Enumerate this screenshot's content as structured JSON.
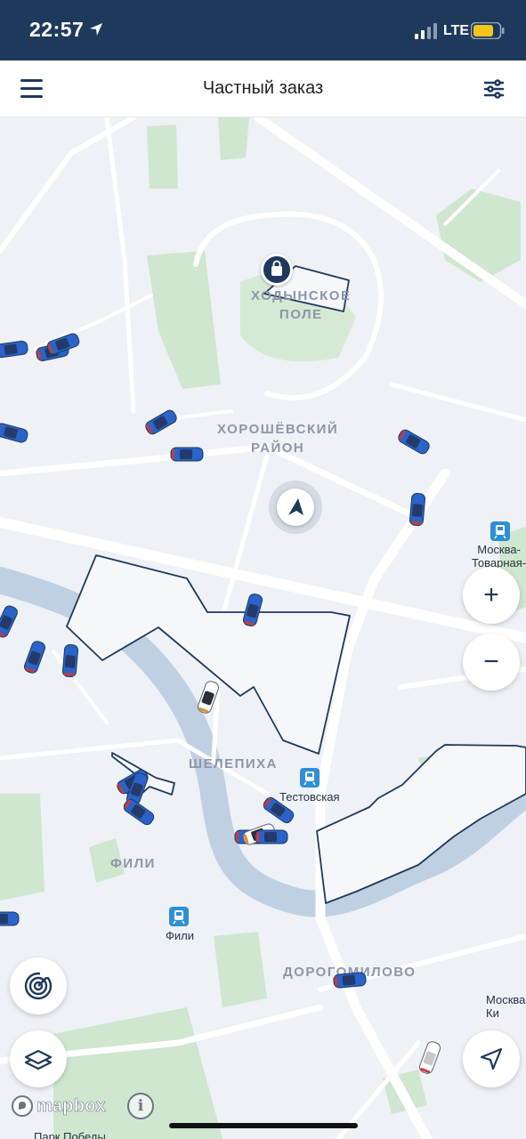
{
  "status_bar": {
    "time": "22:57",
    "network": "LTE",
    "location_icon": "location-arrow-icon",
    "battery_color": "#f4c51c"
  },
  "header": {
    "title": "Частный заказ",
    "menu_icon": "hamburger-menu-icon",
    "filter_icon": "filter-sliders-icon",
    "background": "#ffffff"
  },
  "map": {
    "districts": {
      "khodynskoe_l1": "ХОДЫНСКОЕ",
      "khodynskoe_l2": "ПОЛЕ",
      "khoroshevsky_l1": "ХОРОШЁВСКИЙ",
      "khoroshevsky_l2": "РАЙОН",
      "shelepikha": "ШЕЛЕПИХА",
      "fili": "ФИЛИ",
      "dorogomilovo": "ДОРОГОМИЛОВО"
    },
    "stations": {
      "moskva_tovarnaya_l1": "Москва-",
      "moskva_tovarnaya_l2": "Товарная-",
      "testovskaya": "Тестовская",
      "fili": "Фили",
      "moskva_kiev_l1": "Москва",
      "moskva_kiev_l2": "Ки",
      "park_pobedy": "Парк Победы"
    },
    "colors": {
      "land": "#eef1f6",
      "water": "#bfd0e2",
      "parks": "#cfe6cf",
      "roads": "#ffffff",
      "zone_fill": "#f6f7fb",
      "zone_border": "#1d3a5c",
      "car_body": "#2a63c9",
      "accent": "#1d3a5c"
    },
    "icons": {
      "shopping": "shopping-bag-icon",
      "user_location": "navigation-arrow-icon",
      "metro": "train-icon"
    },
    "cars_count_visible": 27
  },
  "controls": {
    "zoom_in": "+",
    "zoom_out": "−",
    "radar_icon": "radar-icon",
    "layers_icon": "layers-icon",
    "locate_icon": "locate-arrow-icon"
  },
  "attribution": {
    "logo_text": "mapbox",
    "info_label": "i"
  }
}
